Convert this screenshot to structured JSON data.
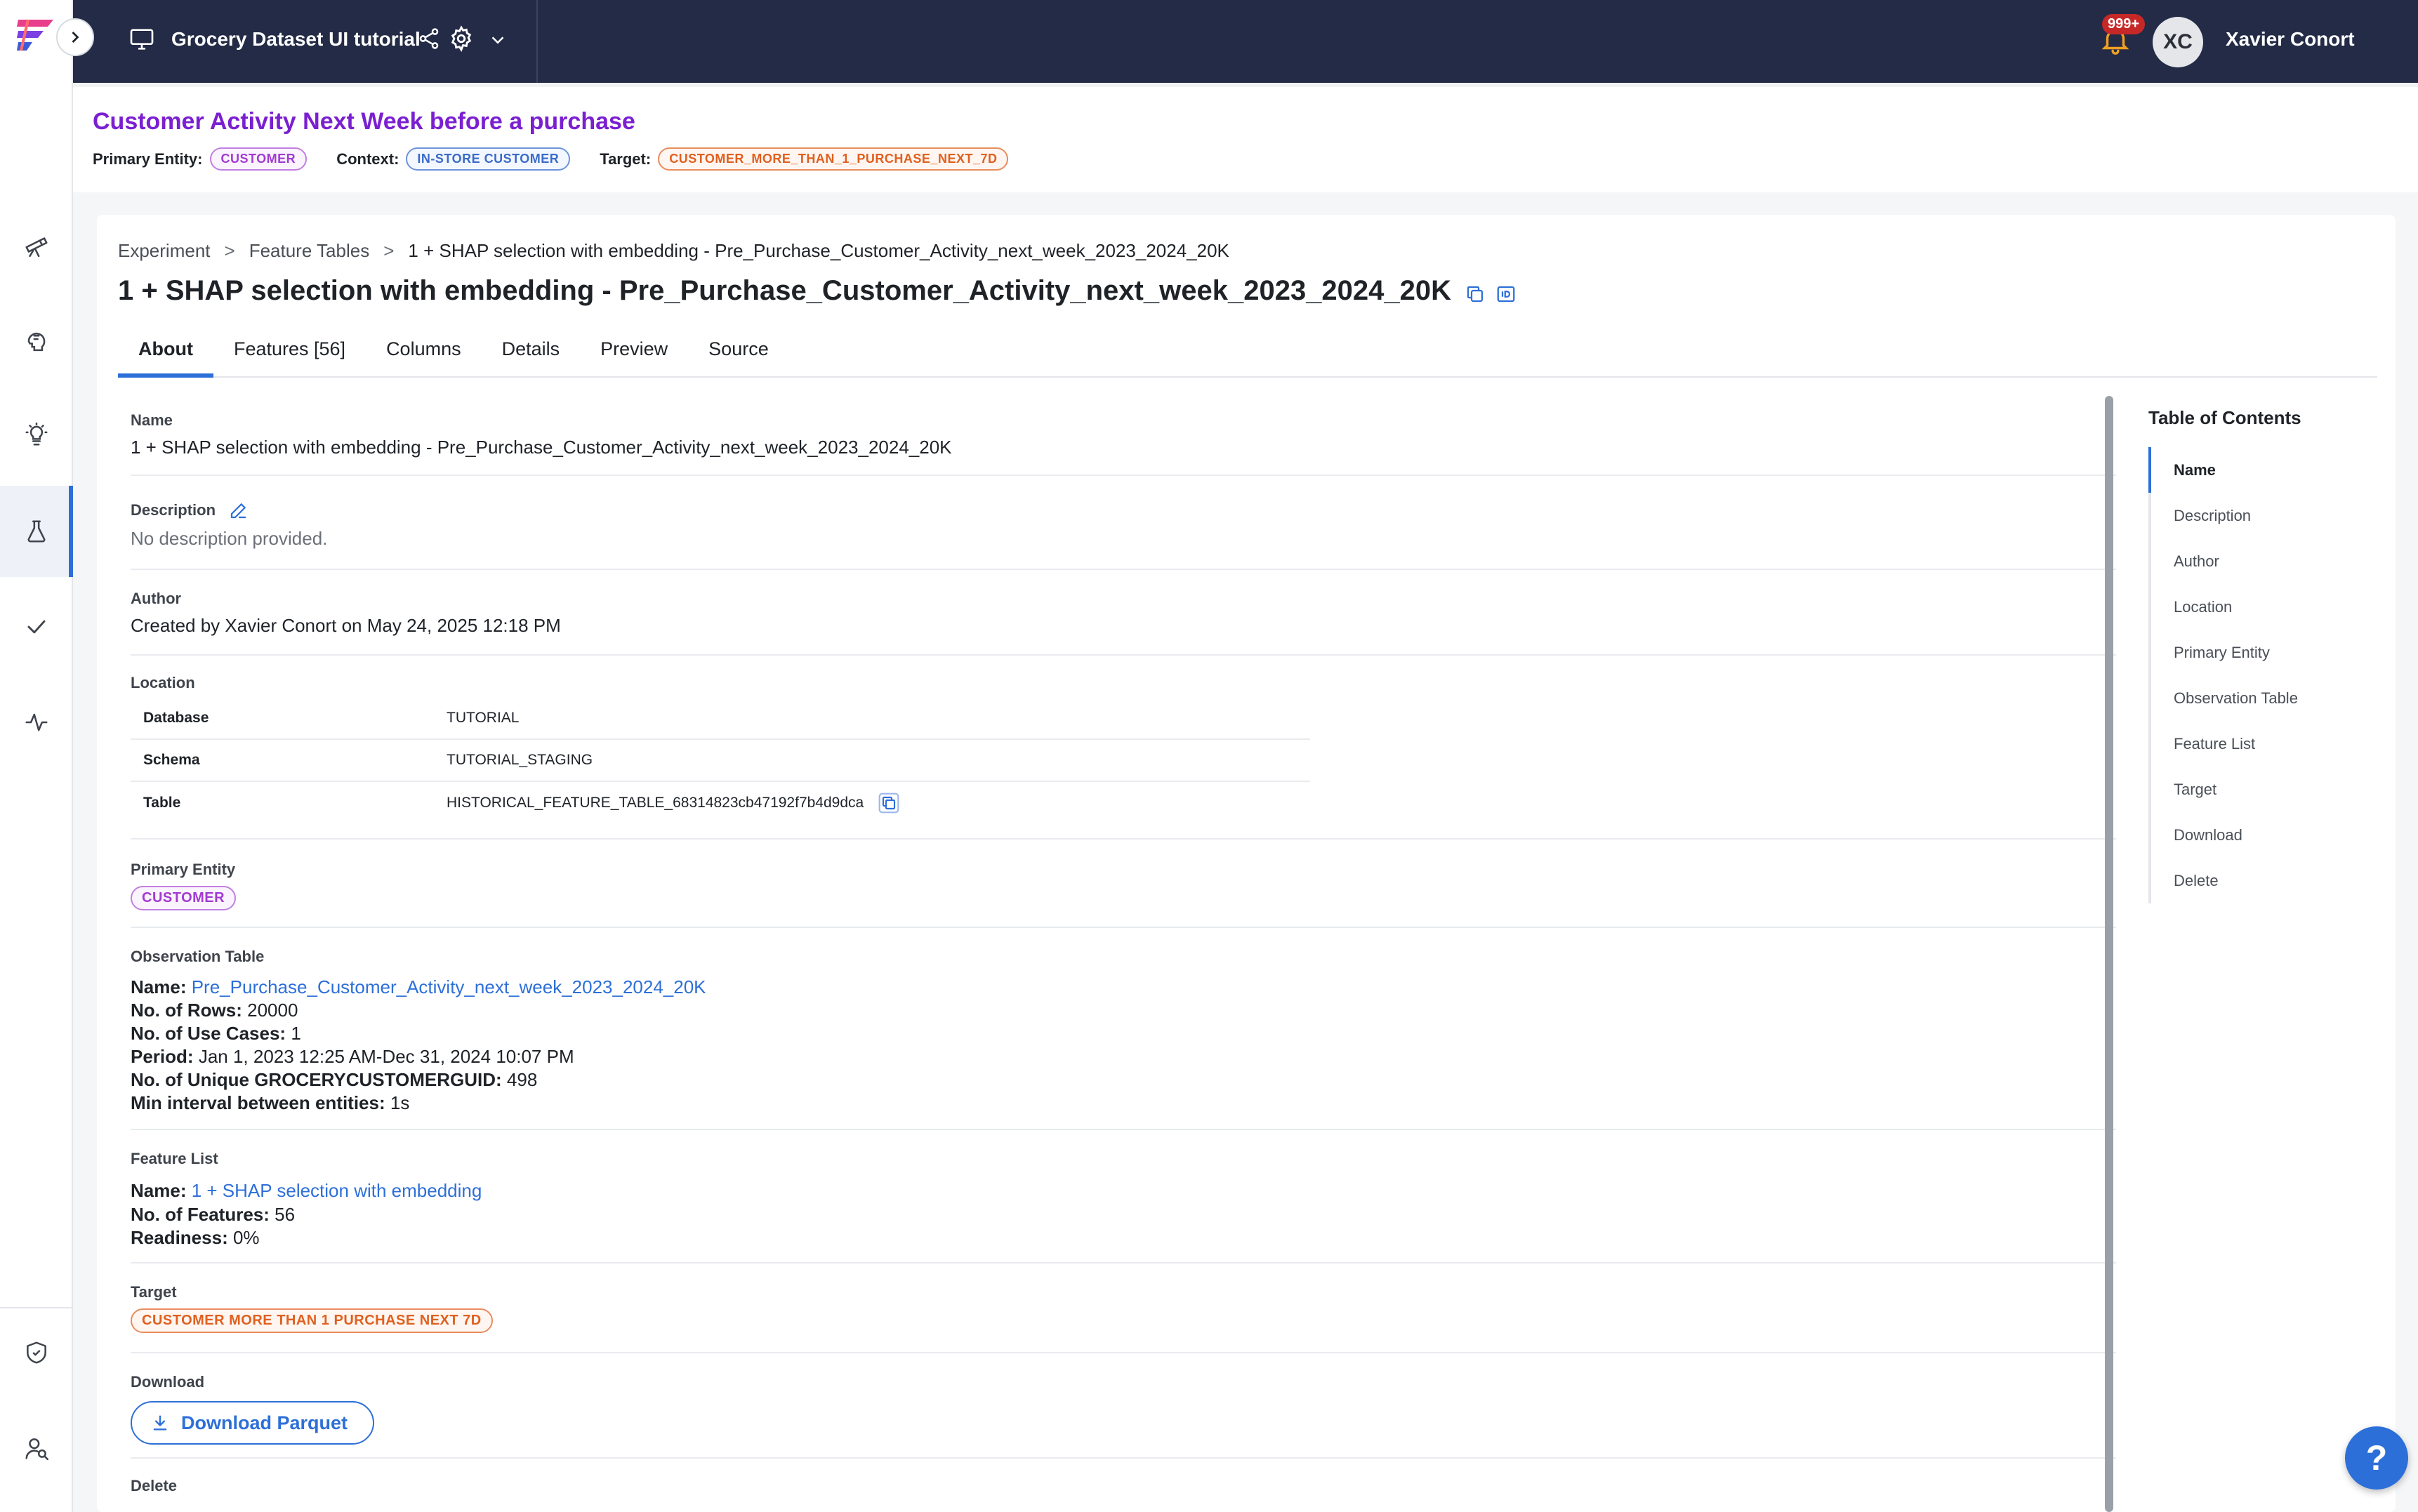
{
  "topbar": {
    "workspace_title": "Grocery Dataset UI tutorial",
    "notification_count": "999+",
    "user_initials": "XC",
    "user_name": "Xavier Conort"
  },
  "use_case": {
    "title": "Customer Activity Next Week before a purchase",
    "primary_entity_label": "Primary Entity:",
    "primary_entity": "CUSTOMER",
    "context_label": "Context:",
    "context": "IN-STORE CUSTOMER",
    "target_label": "Target:",
    "target": "CUSTOMER_MORE_THAN_1_PURCHASE_NEXT_7D"
  },
  "breadcrumb": {
    "items": [
      "Experiment",
      "Feature Tables",
      "1 + SHAP selection with embedding - Pre_Purchase_Customer_Activity_next_week_2023_2024_20K"
    ],
    "separator": ">"
  },
  "page_title": "1 + SHAP selection with embedding - Pre_Purchase_Customer_Activity_next_week_2023_2024_20K",
  "tabs": [
    {
      "label": "About",
      "active": true
    },
    {
      "label": "Features [56]",
      "active": false
    },
    {
      "label": "Columns",
      "active": false
    },
    {
      "label": "Details",
      "active": false
    },
    {
      "label": "Preview",
      "active": false
    },
    {
      "label": "Source",
      "active": false
    }
  ],
  "about": {
    "name_label": "Name",
    "name_value": "1 + SHAP selection with embedding - Pre_Purchase_Customer_Activity_next_week_2023_2024_20K",
    "description_label": "Description",
    "description_value": "No description provided.",
    "author_label": "Author",
    "author_value": "Created by Xavier Conort on May 24, 2025 12:18 PM",
    "location_label": "Location",
    "location_rows": [
      {
        "key": "Database",
        "value": "TUTORIAL"
      },
      {
        "key": "Schema",
        "value": "TUTORIAL_STAGING"
      },
      {
        "key": "Table",
        "value": "HISTORICAL_FEATURE_TABLE_68314823cb47192f7b4d9dca"
      }
    ],
    "primary_entity_label": "Primary Entity",
    "primary_entity_chip": "CUSTOMER",
    "observation_table_label": "Observation Table",
    "observation": {
      "name_key": "Name:",
      "name_value": "Pre_Purchase_Customer_Activity_next_week_2023_2024_20K",
      "rows_key": "No. of Rows:",
      "rows_value": "20000",
      "use_cases_key": "No. of Use Cases:",
      "use_cases_value": "1",
      "period_key": "Period:",
      "period_value": "Jan 1, 2023 12:25 AM-Dec 31, 2024 10:07 PM",
      "unique_key": "No. of Unique GROCERYCUSTOMERGUID:",
      "unique_value": "498",
      "interval_key": "Min interval between entities:",
      "interval_value": "1s"
    },
    "feature_list_label": "Feature List",
    "feature_list": {
      "name_key": "Name:",
      "name_value": "1 + SHAP selection with embedding",
      "features_key": "No. of Features:",
      "features_value": "56",
      "readiness_key": "Readiness:",
      "readiness_value": "0%"
    },
    "target_label": "Target",
    "target_chip": "CUSTOMER MORE THAN 1 PURCHASE NEXT 7D",
    "download_label": "Download",
    "download_button": "Download Parquet",
    "delete_label": "Delete"
  },
  "toc": {
    "title": "Table of Contents",
    "items": [
      "Name",
      "Description",
      "Author",
      "Location",
      "Primary Entity",
      "Observation Table",
      "Feature List",
      "Target",
      "Download",
      "Delete"
    ]
  },
  "help_label": "?",
  "colors": {
    "topbar": "#232b46",
    "accent": "#2d6fd8",
    "use_case_title": "#7b1fd1",
    "entity_chip": "#a23bd1",
    "context_chip": "#3a6bc9",
    "target_chip": "#e0601f",
    "notification": "#c62828"
  }
}
